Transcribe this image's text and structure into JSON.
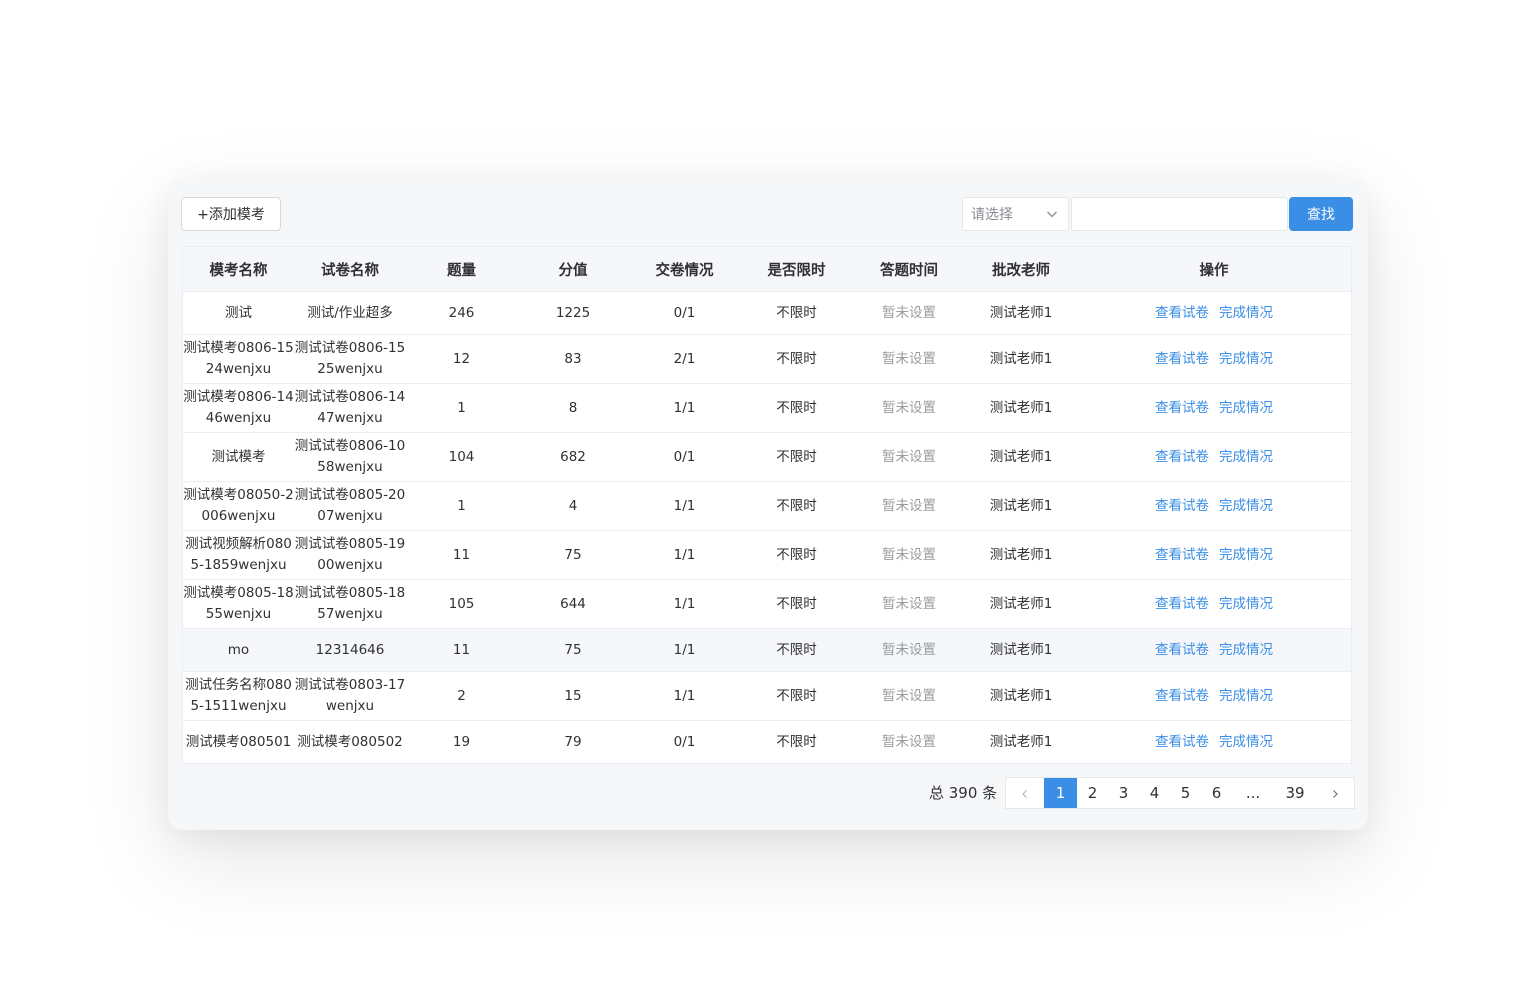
{
  "toolbar": {
    "add_label": "+添加模考",
    "select_placeholder": "请选择",
    "search_value": "",
    "search_label": "查找"
  },
  "table": {
    "columns": [
      "模考名称",
      "试卷名称",
      "题量",
      "分值",
      "交卷情况",
      "是否限时",
      "答题时间",
      "批改老师",
      "操作"
    ],
    "rows": [
      {
        "exam": "测试",
        "paper": "测试/作业超多",
        "count": "246",
        "score": "1225",
        "submit": "0/1",
        "limit": "不限时",
        "time": "暂未设置",
        "teacher": "测试老师1"
      },
      {
        "exam": "测试模考0806-1524wenjxu",
        "paper": "测试试卷0806-1525wenjxu",
        "count": "12",
        "score": "83",
        "submit": "2/1",
        "limit": "不限时",
        "time": "暂未设置",
        "teacher": "测试老师1"
      },
      {
        "exam": "测试模考0806-1446wenjxu",
        "paper": "测试试卷0806-1447wenjxu",
        "count": "1",
        "score": "8",
        "submit": "1/1",
        "limit": "不限时",
        "time": "暂未设置",
        "teacher": "测试老师1"
      },
      {
        "exam": "测试模考",
        "paper": "测试试卷0806-1058wenjxu",
        "count": "104",
        "score": "682",
        "submit": "0/1",
        "limit": "不限时",
        "time": "暂未设置",
        "teacher": "测试老师1"
      },
      {
        "exam": "测试模考08050-2006wenjxu",
        "paper": "测试试卷0805-2007wenjxu",
        "count": "1",
        "score": "4",
        "submit": "1/1",
        "limit": "不限时",
        "time": "暂未设置",
        "teacher": "测试老师1"
      },
      {
        "exam": "测试视频解析0805-1859wenjxu",
        "paper": "测试试卷0805-1900wenjxu",
        "count": "11",
        "score": "75",
        "submit": "1/1",
        "limit": "不限时",
        "time": "暂未设置",
        "teacher": "测试老师1"
      },
      {
        "exam": "测试模考0805-1855wenjxu",
        "paper": "测试试卷0805-1857wenjxu",
        "count": "105",
        "score": "644",
        "submit": "1/1",
        "limit": "不限时",
        "time": "暂未设置",
        "teacher": "测试老师1"
      },
      {
        "exam": "mo",
        "paper": "12314646",
        "count": "11",
        "score": "75",
        "submit": "1/1",
        "limit": "不限时",
        "time": "暂未设置",
        "teacher": "测试老师1"
      },
      {
        "exam": "测试任务名称0805-1511wenjxu",
        "paper": "测试试卷0803-17wenjxu",
        "count": "2",
        "score": "15",
        "submit": "1/1",
        "limit": "不限时",
        "time": "暂未设置",
        "teacher": "测试老师1"
      },
      {
        "exam": "测试模考080501",
        "paper": "测试模考080502",
        "count": "19",
        "score": "79",
        "submit": "0/1",
        "limit": "不限时",
        "time": "暂未设置",
        "teacher": "测试老师1"
      }
    ],
    "action_view": "查看试卷",
    "action_done": "完成情况"
  },
  "pagination": {
    "total": "总 390 条",
    "pages": [
      "1",
      "2",
      "3",
      "4",
      "5",
      "6",
      "...",
      "39"
    ],
    "current": "1"
  },
  "colors": {
    "accent": "#3a8ee6",
    "muted_text": "#9a9ca1"
  }
}
